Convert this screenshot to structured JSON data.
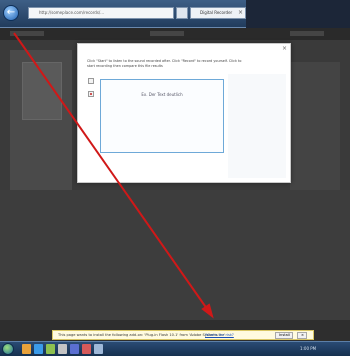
{
  "browser": {
    "address": "http://someplace.com/records/...",
    "tab_title": "Digital Recorder",
    "tab_close": "×",
    "back": "←"
  },
  "dialog": {
    "close": "×",
    "instructions": "Click \"Start\" to listen to the sound recorded after. Click \"Record\" to record yourself. Click to start recording then compare this file results",
    "preview_text": "Ex. Der Text deutlich"
  },
  "notification": {
    "message": "This page wants to install the following add-on: 'Plug-in Flash 10.1' from 'Adobe Systems Inc'",
    "link": "What's the risk?",
    "install": "Install",
    "dismiss": "×"
  },
  "taskbar": {
    "tray_text": "1:00 PM"
  },
  "colors": {
    "annotation_arrow": "#d01818",
    "dialog_accent": "#6ea9d8"
  }
}
